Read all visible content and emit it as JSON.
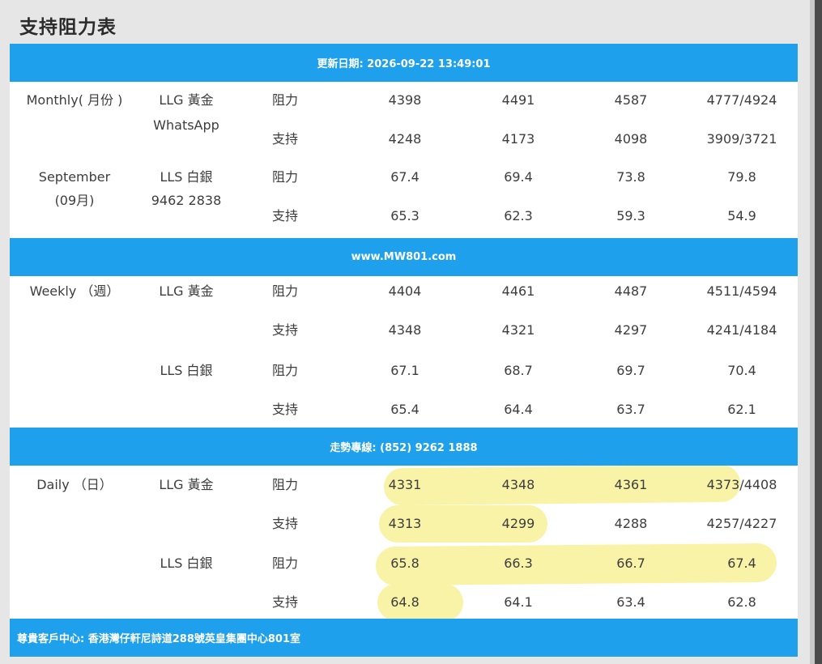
{
  "title": "支持阻力表",
  "bands": {
    "update": "更新日期: 2026-09-22 13:49:01",
    "website": "www.MW801.com",
    "hotline": "走勢專線: (852) 9262 1888",
    "footer": "尊貴客戶中心: 香港灣仔軒尼詩道288號英皇集團中心801室"
  },
  "monthly": {
    "period_lines": [
      "Monthly( 月份 )",
      "September",
      "(09月)"
    ],
    "gold_lines": [
      "LLG 黃金",
      "WhatsApp"
    ],
    "silver_lines": [
      "LLS 白銀",
      "9462 2838"
    ],
    "rows": [
      {
        "type": "阻力",
        "v": [
          "4398",
          "4491",
          "4587",
          "4777/4924"
        ]
      },
      {
        "type": "支持",
        "v": [
          "4248",
          "4173",
          "4098",
          "3909/3721"
        ]
      },
      {
        "type": "阻力",
        "v": [
          "67.4",
          "69.4",
          "73.8",
          "79.8"
        ]
      },
      {
        "type": "支持",
        "v": [
          "65.3",
          "62.3",
          "59.3",
          "54.9"
        ]
      }
    ]
  },
  "weekly": {
    "period": "Weekly （週）",
    "gold": "LLG 黃金",
    "silver": "LLS 白銀",
    "rows": [
      {
        "type": "阻力",
        "v": [
          "4404",
          "4461",
          "4487",
          "4511/4594"
        ]
      },
      {
        "type": "支持",
        "v": [
          "4348",
          "4321",
          "4297",
          "4241/4184"
        ]
      },
      {
        "type": "阻力",
        "v": [
          "67.1",
          "68.7",
          "69.7",
          "70.4"
        ]
      },
      {
        "type": "支持",
        "v": [
          "65.4",
          "64.4",
          "63.7",
          "62.1"
        ]
      }
    ]
  },
  "daily": {
    "period": "Daily （日）",
    "gold": "LLG 黃金",
    "silver": "LLS 白銀",
    "rows": [
      {
        "type": "阻力",
        "v": [
          "4331",
          "4348",
          "4361",
          "4373/4408"
        ]
      },
      {
        "type": "支持",
        "v": [
          "4313",
          "4299",
          "4288",
          "4257/4227"
        ]
      },
      {
        "type": "阻力",
        "v": [
          "65.8",
          "66.3",
          "66.7",
          "67.4"
        ]
      },
      {
        "type": "支持",
        "v": [
          "64.8",
          "64.1",
          "63.4",
          "62.8"
        ]
      }
    ]
  }
}
